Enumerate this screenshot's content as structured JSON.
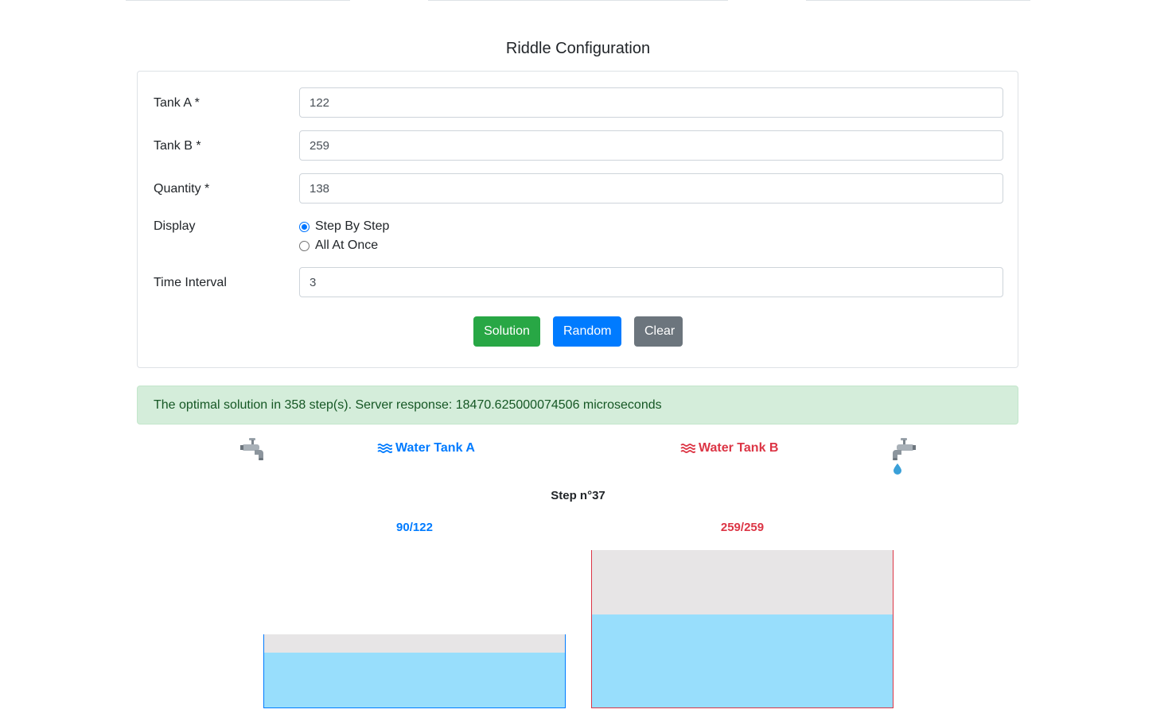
{
  "form": {
    "title": "Riddle Configuration",
    "tank_a_label": "Tank A *",
    "tank_a_value": "122",
    "tank_b_label": "Tank B *",
    "tank_b_value": "259",
    "quantity_label": "Quantity *",
    "quantity_value": "138",
    "display_label": "Display",
    "display_options": [
      "Step By Step",
      "All At Once"
    ],
    "display_selected": "Step By Step",
    "interval_label": "Time Interval",
    "interval_value": "3",
    "solution_button": "Solution",
    "random_button": "Random",
    "clear_button": "Clear"
  },
  "result": {
    "message": "The optimal solution in 358 step(s). Server response: 18470.625000074506 microseconds"
  },
  "simulation": {
    "tank_a": {
      "name": "Water Tank A",
      "level_text": "90/122",
      "current": 90,
      "capacity": 122,
      "color": "#007bff",
      "faucet_dripping": false
    },
    "tank_b": {
      "name": "Water Tank B",
      "level_text": "259/259",
      "current": 259,
      "capacity": 259,
      "color": "#dc3545",
      "faucet_dripping": true
    },
    "step_text": "Step n°37",
    "water_color": "#98defc",
    "empty_color": "#e7e5e6"
  },
  "icons": {
    "faucet": "faucet-icon",
    "drop": "water-drop-icon",
    "waves": "water-waves-icon"
  }
}
